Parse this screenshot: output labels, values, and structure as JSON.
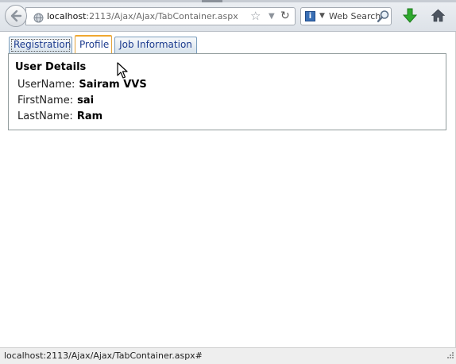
{
  "browser": {
    "url_host": "localhost",
    "url_rest": ":2113/Ajax/Ajax/TabContainer.aspx",
    "search_placeholder": "Web Search",
    "icons": {
      "back": "back-arrow-icon",
      "globe": "globe-icon",
      "bookmark": "star-icon",
      "reload": "reload-icon",
      "search_engine": "info-icon",
      "search": "magnifier-icon",
      "download": "download-arrow-icon",
      "home": "home-icon"
    },
    "colors": {
      "download": "#2eaa2e",
      "tab_active_border": "#f0a830",
      "tab_text": "#1d3c8f"
    }
  },
  "tabs": [
    {
      "label": "Registration",
      "active": false
    },
    {
      "label": "Profile",
      "active": true
    },
    {
      "label": "Job Information",
      "active": false
    }
  ],
  "profile": {
    "section_title": "User Details",
    "fields": [
      {
        "label": "UserName:",
        "value": "Sairam VVS"
      },
      {
        "label": "FirstName:",
        "value": "sai"
      },
      {
        "label": "LastName:",
        "value": "Ram"
      }
    ]
  },
  "status": {
    "text": "localhost:2113/Ajax/Ajax/TabContainer.aspx#"
  }
}
